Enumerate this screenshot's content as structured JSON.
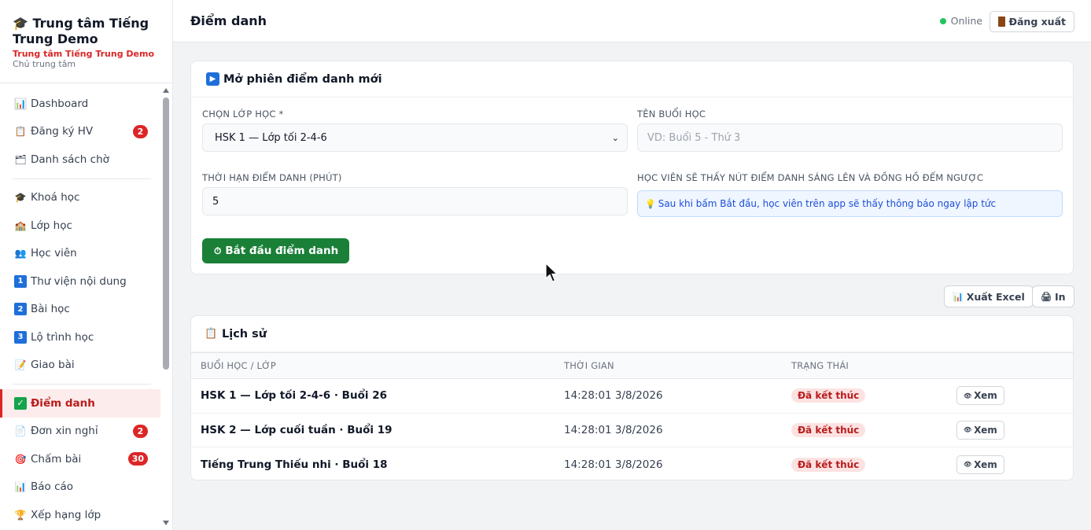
{
  "sidebar": {
    "brand_title": "🎓 Trung tâm Tiếng Trung Demo",
    "brand_sub": "Trung tâm Tiếng Trung Demo",
    "brand_role": "Chủ trung tâm",
    "items": [
      {
        "label": "Dashboard",
        "icon": "📊"
      },
      {
        "label": "Đăng ký HV",
        "icon": "📋",
        "badge": "2"
      },
      {
        "label": "Danh sách chờ",
        "icon": "🗂"
      },
      {
        "label": "Khoá học",
        "icon": "🎓"
      },
      {
        "label": "Lớp học",
        "icon": "🏫"
      },
      {
        "label": "Học viên",
        "icon": "👥"
      },
      {
        "label": "Thư viện nội dung",
        "icon": "1"
      },
      {
        "label": "Bài học",
        "icon": "2"
      },
      {
        "label": "Lộ trình học",
        "icon": "3"
      },
      {
        "label": "Giao bài",
        "icon": "📝"
      },
      {
        "label": "Điểm danh",
        "icon": "✓"
      },
      {
        "label": "Đơn xin nghỉ",
        "icon": "📄",
        "badge": "2"
      },
      {
        "label": "Chấm bài",
        "icon": "🎯",
        "badge": "30"
      },
      {
        "label": "Báo cáo",
        "icon": "📊"
      },
      {
        "label": "Xếp hạng lớp",
        "icon": "🏆"
      }
    ]
  },
  "header": {
    "title": "Điểm danh",
    "status": "Online",
    "logout_label": "Đăng xuất"
  },
  "new_session": {
    "title": "Mở phiên điểm danh mới",
    "class_label": "CHỌN LỚP HỌC *",
    "class_value": "HSK 1 — Lớp tối 2-4-6",
    "session_name_label": "TÊN BUỔI HỌC",
    "session_name_placeholder": "VD: Buổi 5 - Thứ 3",
    "duration_label": "THỜI HẠN ĐIỂM DANH (PHÚT)",
    "duration_value": "5",
    "hint_label": "HỌC VIÊN SẼ THẤY NÚT ĐIỂM DANH SÁNG LÊN VÀ ĐỒNG HỒ ĐẾM NGƯỢC",
    "hint_text": "Sau khi bấm Bắt đầu, học viên trên app sẽ thấy thông báo ngay lập tức",
    "start_label": "Bắt đầu điểm danh"
  },
  "toolbar": {
    "export_label": "Xuất Excel",
    "print_label": "In"
  },
  "history": {
    "title": "Lịch sử",
    "columns": [
      "BUỔI HỌC / LỚP",
      "THỜI GIAN",
      "TRẠNG THÁI",
      ""
    ],
    "rows": [
      {
        "session": "HSK 1 — Lớp tối 2-4-6 · Buổi 26",
        "time": "14:28:01 3/8/2026",
        "status": "Đã kết thúc",
        "action": "Xem"
      },
      {
        "session": "HSK 2 — Lớp cuối tuần · Buổi 19",
        "time": "14:28:01 3/8/2026",
        "status": "Đã kết thúc",
        "action": "Xem"
      },
      {
        "session": "Tiếng Trung Thiếu nhi · Buổi 18",
        "time": "14:28:01 3/8/2026",
        "status": "Đã kết thúc",
        "action": "Xem"
      }
    ]
  },
  "colors": {
    "accent": "#dc2626",
    "primary_button": "#1a7f37",
    "status_badge_bg": "#fde2e2"
  }
}
